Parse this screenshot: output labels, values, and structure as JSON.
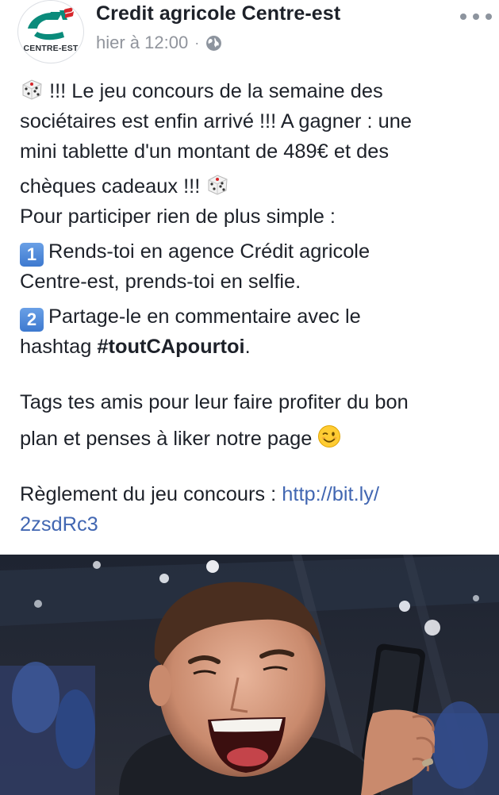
{
  "post": {
    "page_name": "Credit agricole Centre-est",
    "timestamp": "hier à 12:00",
    "separator": "·",
    "privacy_icon": "globe-icon",
    "more_icon": "more-dots-icon",
    "avatar": {
      "logo_icon": "credit-agricole-logo-icon",
      "caption": "CENTRE-EST"
    },
    "body": {
      "line1": "!!! Le jeu concours de la semaine des",
      "line2": "sociétaires est enfin arrivé !!! A gagner : une",
      "line3": "mini tablette d'un montant de 489€ et des",
      "line4": "chèques cadeaux !!!",
      "line5": "Pour participer rien de plus simple :",
      "step1_number": "1",
      "step1_line1": "Rends-toi en agence Crédit agricole",
      "step1_line2": "Centre-est, prends-toi en selfie.",
      "step2_number": "2",
      "step2_line1": "Partage-le en commentaire avec le",
      "step2_line2_prefix": "hashtag ",
      "hashtag": "#toutCApourtoi",
      "step2_line2_suffix": ".",
      "tags_line1": "Tags tes amis pour leur faire profiter du bon",
      "tags_line2": "plan et penses à liker notre page",
      "rules_label": "Règlement du jeu concours : ",
      "rules_link_part1": "http://bit.ly/",
      "rules_link_part2": "2zsdRc3",
      "emoji_die": "game-die-icon",
      "emoji_wink": "winking-face-icon"
    },
    "media": {
      "description_icon": "photo-laughing-man-with-phone"
    },
    "colors": {
      "text": "#1d2129",
      "meta": "#90949c",
      "link": "#4267b2",
      "brand_green": "#0a8b7b",
      "brand_red": "#d7262b",
      "keycap_blue": "#4a86d8"
    }
  }
}
